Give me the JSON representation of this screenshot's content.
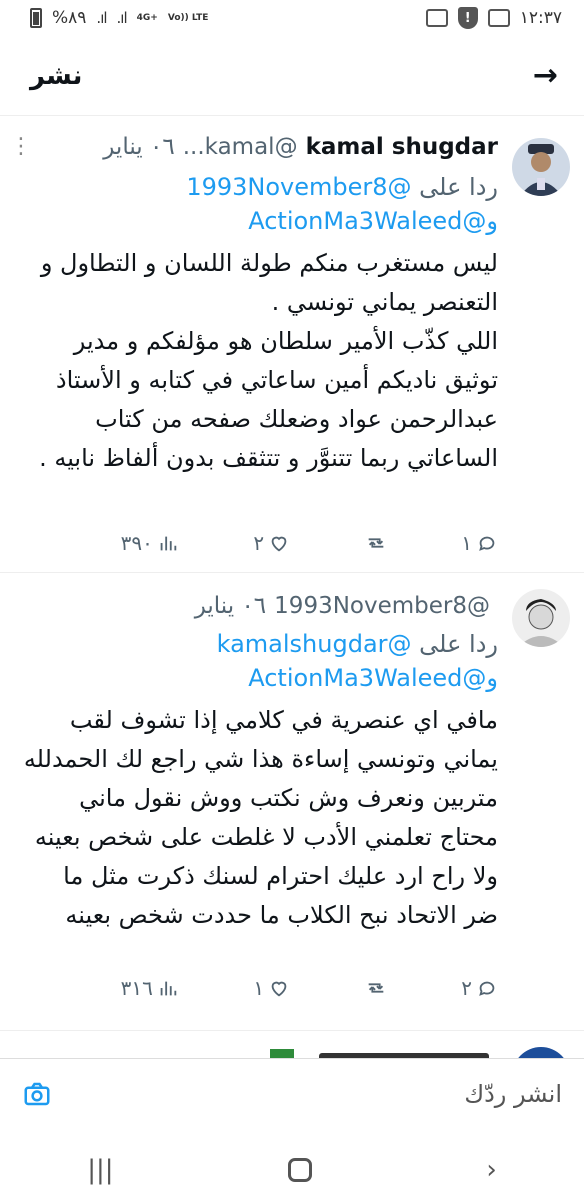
{
  "status_bar": {
    "time": "١٢:٣٧",
    "battery": "%٨٩",
    "network": "4G+",
    "lte": "Vo)) LTE"
  },
  "header": {
    "title": "نشر"
  },
  "replies": [
    {
      "name": "kamal shugdar",
      "handle": "@kamal...",
      "date": "٠٦ يناير",
      "reply_to_prefix": "ردا على",
      "mention1": "@1993November8",
      "mention2_prefix": "و",
      "mention2": "@ActionMa3Waleed",
      "text": "ليس مستغرب منكم طولة اللسان و التطاول و التعنصر يماني تونسي .\nاللي كذّب الأمير سلطان هو مؤلفكم و مدير توثيق ناديكم أمين ساعاتي في كتابه و الأستاذ عبدالرحمن عواد وضعلك صفحه من كتاب الساعاتي ربما تتنوَّر و تتثقف بدون ألفاظ نابيه .",
      "comments": "١",
      "retweets": "",
      "likes": "٢",
      "views": "٣٩٠"
    },
    {
      "name": "",
      "handle": "@1993November8",
      "date": "٠٦ يناير",
      "reply_to_prefix": "ردا على",
      "mention1": "@kamalshugdar",
      "mention2_prefix": "و",
      "mention2": "@ActionMa3Waleed",
      "text": "مافي اي عنصرية في كلامي إذا تشوف لقب يماني وتونسي إساءة هذا شي راجع لك الحمدلله متربين ونعرف وش نكتب ووش نقول ماني محتاج تعلمني الأدب لا غلطت على شخص بعينه ولا راح ارد عليك احترام لسنك ذكرت مثل ما ضر الاتحاد نبح الكلاب ما حددت شخص بعينه",
      "comments": "٢",
      "retweets": "",
      "likes": "١",
      "views": "٣١٦"
    }
  ],
  "composer": {
    "placeholder": "انشر ردّك"
  }
}
